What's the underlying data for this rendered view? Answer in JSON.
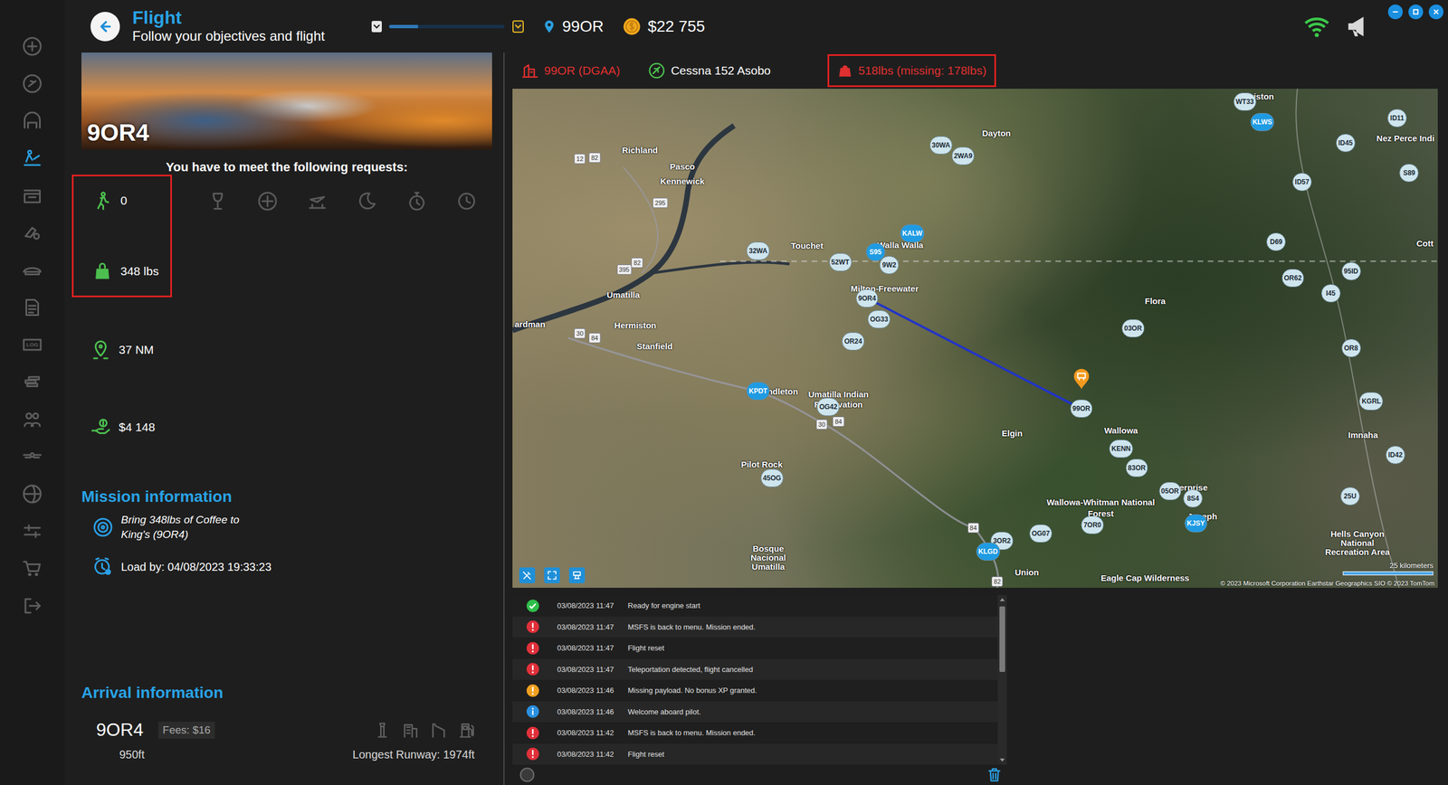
{
  "window": {
    "title": "Flight",
    "subtitle": "Follow your objectives and flight"
  },
  "sidebar": {
    "items": [
      {
        "selected": false
      },
      {
        "selected": false
      },
      {
        "selected": false
      },
      {
        "selected": true
      },
      {
        "selected": false
      },
      {
        "selected": false
      },
      {
        "selected": false
      },
      {
        "selected": false
      },
      {
        "selected": false,
        "label": "LOG"
      },
      {
        "selected": false
      },
      {
        "selected": false
      },
      {
        "selected": false
      },
      {
        "selected": false
      },
      {
        "selected": false
      },
      {
        "selected": false
      },
      {
        "selected": false
      }
    ]
  },
  "toolbar": {
    "progress": {
      "level": 0.25
    },
    "location": "99OR",
    "balance": "$22 755"
  },
  "status": {
    "departure": "99OR (DGAA)",
    "aircraft": "Cessna 152 Asobo",
    "payload": "518lbs (missing: 178lbs)",
    "payload_warning": true
  },
  "mission_panel": {
    "banner_title": "9OR4",
    "requests_title": "You have to meet the following requests:",
    "passengers": "0",
    "cargo": "348 lbs",
    "requirements_flagged": true,
    "requests": [
      {
        "active": false
      },
      {
        "active": false
      },
      {
        "active": false
      },
      {
        "active": false
      },
      {
        "active": false
      },
      {
        "active": false
      }
    ],
    "distance": "37 NM",
    "pay": "$4 148"
  },
  "mission_info": {
    "title": "Mission information",
    "objective": "Bring 348lbs of Coffee to King's (9OR4)",
    "deadline": "Load by: 04/08/2023 19:33:23"
  },
  "arrival": {
    "title": "Arrival information",
    "icao": "9OR4",
    "fees": "Fees: $16",
    "facilities": [
      {
        "available": false
      },
      {
        "available": false
      },
      {
        "available": false
      },
      {
        "available": false
      }
    ],
    "elevation": "950ft",
    "runway": "Longest Runway: 1974ft"
  },
  "map": {
    "places": [
      {
        "text": "wiston"
      },
      {
        "text": "Richland"
      },
      {
        "text": "Pasco"
      },
      {
        "text": "Kennewick"
      },
      {
        "text": "Dayton"
      },
      {
        "text": "Touchet"
      },
      {
        "text": "Walla Walla"
      },
      {
        "text": "Milton-Freewater"
      },
      {
        "text": "Umatilla"
      },
      {
        "text": "Hermiston"
      },
      {
        "text": "Stanfield"
      },
      {
        "text": "ardman"
      },
      {
        "text": "Pendleton"
      },
      {
        "text": "Umatilla Indian"
      },
      {
        "text": "Reservation"
      },
      {
        "text": "Pilot Rock"
      },
      {
        "text": "Elgin"
      },
      {
        "text": "Flora"
      },
      {
        "text": "Wallowa"
      },
      {
        "text": "Wallowa-Whitman National"
      },
      {
        "text": "Forest"
      },
      {
        "text": "Enterprise"
      },
      {
        "text": "Joseph"
      },
      {
        "text": "Imnaha"
      },
      {
        "text": "Hells Canyon"
      },
      {
        "text": "National"
      },
      {
        "text": "Recreation Area"
      },
      {
        "text": "Eagle Cap Wilderness"
      },
      {
        "text": "Union"
      },
      {
        "text": "Bosque"
      },
      {
        "text": "Nacional"
      },
      {
        "text": "Umatilla"
      },
      {
        "text": "Nez Perce Indi"
      },
      {
        "text": "Cott"
      }
    ],
    "roads": [
      {
        "text": "12"
      },
      {
        "text": "82"
      },
      {
        "text": "295"
      },
      {
        "text": "395"
      },
      {
        "text": "82"
      },
      {
        "text": "30"
      },
      {
        "text": "84"
      },
      {
        "text": "30"
      },
      {
        "text": "84"
      },
      {
        "text": "84"
      },
      {
        "text": "82"
      }
    ],
    "airports": [
      {
        "code": "WT33",
        "color": "#cfe5ee"
      },
      {
        "code": "KLWS",
        "color": "#1f9be3"
      },
      {
        "code": "ID11",
        "color": "#cfe5ee"
      },
      {
        "code": "ID45",
        "color": "#cfe5ee"
      },
      {
        "code": "S89",
        "color": "#cfe5ee"
      },
      {
        "code": "ID57",
        "color": "#cfe5ee"
      },
      {
        "code": "D69",
        "color": "#cfe5ee"
      },
      {
        "code": "95ID",
        "color": "#cfe5ee"
      },
      {
        "code": "OR62",
        "color": "#cfe5ee"
      },
      {
        "code": "I45",
        "color": "#cfe5ee"
      },
      {
        "code": "OR8",
        "color": "#cfe5ee"
      },
      {
        "code": "KGRL",
        "color": "#cfe5ee"
      },
      {
        "code": "ID42",
        "color": "#cfe5ee"
      },
      {
        "code": "25U",
        "color": "#cfe5ee"
      },
      {
        "code": "30WA",
        "color": "#cfe5ee"
      },
      {
        "code": "2WA9",
        "color": "#cfe5ee"
      },
      {
        "code": "KALW",
        "color": "#1f9be3"
      },
      {
        "code": "S95",
        "color": "#1f9be3"
      },
      {
        "code": "9W2",
        "color": "#cfe5ee"
      },
      {
        "code": "52WT",
        "color": "#cfe5ee"
      },
      {
        "code": "32WA",
        "color": "#cfe5ee"
      },
      {
        "code": "9OR4",
        "color": "#cfe5ee"
      },
      {
        "code": "OG33",
        "color": "#cfe5ee"
      },
      {
        "code": "OR24",
        "color": "#cfe5ee"
      },
      {
        "code": "03OR",
        "color": "#cfe5ee"
      },
      {
        "code": "KPDT",
        "color": "#1f9be3"
      },
      {
        "code": "OG42",
        "color": "#cfe5ee"
      },
      {
        "code": "45OG",
        "color": "#cfe5ee"
      },
      {
        "code": "99OR",
        "color": "#cfe5ee"
      },
      {
        "code": "KENN",
        "color": "#cfe5ee"
      },
      {
        "code": "83OR",
        "color": "#cfe5ee"
      },
      {
        "code": "05OR",
        "color": "#cfe5ee"
      },
      {
        "code": "8S4",
        "color": "#cfe5ee"
      },
      {
        "code": "KJSY",
        "color": "#1f9be3"
      },
      {
        "code": "7OR0",
        "color": "#cfe5ee"
      },
      {
        "code": "OG07",
        "color": "#cfe5ee"
      },
      {
        "code": "3OR2",
        "color": "#cfe5ee"
      },
      {
        "code": "KLGD",
        "color": "#1f9be3"
      }
    ],
    "scale": "25 kilometers",
    "attribution": "© 2023 Microsoft Corporation Earthstar Geographics SIO © 2023 TomTom"
  },
  "log": {
    "entries": [
      {
        "kind": "success",
        "time": "03/08/2023 11:47",
        "message": "Ready for engine start"
      },
      {
        "kind": "error",
        "time": "03/08/2023 11:47",
        "message": "MSFS is back to menu. Mission ended."
      },
      {
        "kind": "error",
        "time": "03/08/2023 11:47",
        "message": "Flight reset"
      },
      {
        "kind": "error",
        "time": "03/08/2023 11:47",
        "message": "Teleportation detected, flight cancelled"
      },
      {
        "kind": "warning",
        "time": "03/08/2023 11:46",
        "message": "Missing payload. No bonus XP granted."
      },
      {
        "kind": "info",
        "time": "03/08/2023 11:46",
        "message": "Welcome aboard pilot."
      },
      {
        "kind": "error",
        "time": "03/08/2023 11:42",
        "message": "MSFS is back to menu. Mission ended."
      },
      {
        "kind": "error",
        "time": "03/08/2023 11:42",
        "message": "Flight reset"
      }
    ],
    "scrollbar": {
      "level": 0.44
    }
  }
}
